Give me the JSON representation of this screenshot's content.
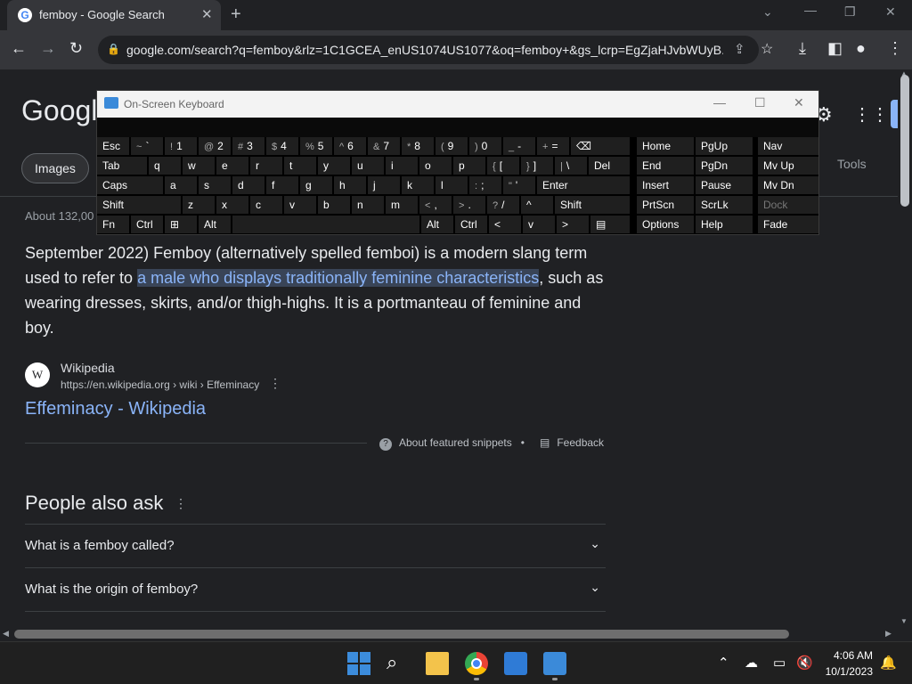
{
  "browser": {
    "tab_title": "femboy - Google Search",
    "tab_icon": "G",
    "url": "google.com/search?q=femboy&rlz=1C1GCEA_enUS1074US1077&oq=femboy+&gs_lcrp=EgZjaHJvbWUyB..."
  },
  "google": {
    "logo": "Google",
    "images_tab": "Images",
    "tools": "Tools",
    "about_results": "About 132,00",
    "snippet_before": "September 2022) Femboy (alternatively spelled femboi) is a modern slang term used to refer to ",
    "snippet_highlight": "a male who displays traditionally feminine characteristics",
    "snippet_after": ", such as wearing dresses, skirts, and/or thigh-highs. It is a portmanteau of feminine and boy.",
    "source_icon": "W",
    "source_name": "Wikipedia",
    "source_url": "https://en.wikipedia.org › wiki › Effeminacy",
    "result_link": "Effeminacy - Wikipedia",
    "about_snippets": "About featured snippets",
    "separator": "•",
    "feedback": "Feedback",
    "paa_title": "People also ask",
    "paa_questions": [
      "What is a femboy called?",
      "What is the origin of femboy?"
    ]
  },
  "osk": {
    "title": "On-Screen Keyboard",
    "keys": {
      "esc": "Esc",
      "tilde": [
        "~",
        "`"
      ],
      "n1": [
        "!",
        "1"
      ],
      "n2": [
        "@",
        "2"
      ],
      "n3": [
        "#",
        "3"
      ],
      "n4": [
        "$",
        "4"
      ],
      "n5": [
        "%",
        "5"
      ],
      "n6": [
        "^",
        "6"
      ],
      "n7": [
        "&",
        "7"
      ],
      "n8": [
        "*",
        "8"
      ],
      "n9": [
        "(",
        "9"
      ],
      "n0": [
        ")",
        "0"
      ],
      "minus": [
        "_",
        "-"
      ],
      "equals": [
        "+",
        "="
      ],
      "tab": "Tab",
      "q": "q",
      "w": "w",
      "e": "e",
      "r": "r",
      "t": "t",
      "y": "y",
      "u": "u",
      "i": "i",
      "o": "o",
      "p": "p",
      "lbracket": [
        "{",
        "["
      ],
      "rbracket": [
        "}",
        "]"
      ],
      "backslash": [
        "|",
        "\\"
      ],
      "del": "Del",
      "caps": "Caps",
      "a": "a",
      "s": "s",
      "d": "d",
      "f": "f",
      "g": "g",
      "h": "h",
      "j": "j",
      "k": "k",
      "l": "l",
      "semicolon": [
        ":",
        ";"
      ],
      "quote": [
        "\"",
        "'"
      ],
      "enter": "Enter",
      "shift": "Shift",
      "z": "z",
      "x": "x",
      "c": "c",
      "v": "v",
      "b": "b",
      "n": "n",
      "m": "m",
      "comma": [
        "<",
        ","
      ],
      "period": [
        ">",
        "."
      ],
      "slash": [
        "?",
        "/"
      ],
      "up": "^",
      "shift_r": "Shift",
      "fn": "Fn",
      "ctrl": "Ctrl",
      "alt": "Alt",
      "alt_r": "Alt",
      "ctrl_r": "Ctrl",
      "left": "<",
      "down": "v",
      "right": ">",
      "home": "Home",
      "pgup": "PgUp",
      "nav": "Nav",
      "end": "End",
      "pgdn": "PgDn",
      "mvup": "Mv Up",
      "insert": "Insert",
      "pause": "Pause",
      "mvdn": "Mv Dn",
      "prtscn": "PrtScn",
      "scrlk": "ScrLk",
      "dock": "Dock",
      "options": "Options",
      "help": "Help",
      "fade": "Fade"
    }
  },
  "taskbar": {
    "time": "4:06 AM",
    "date": "10/1/2023"
  }
}
